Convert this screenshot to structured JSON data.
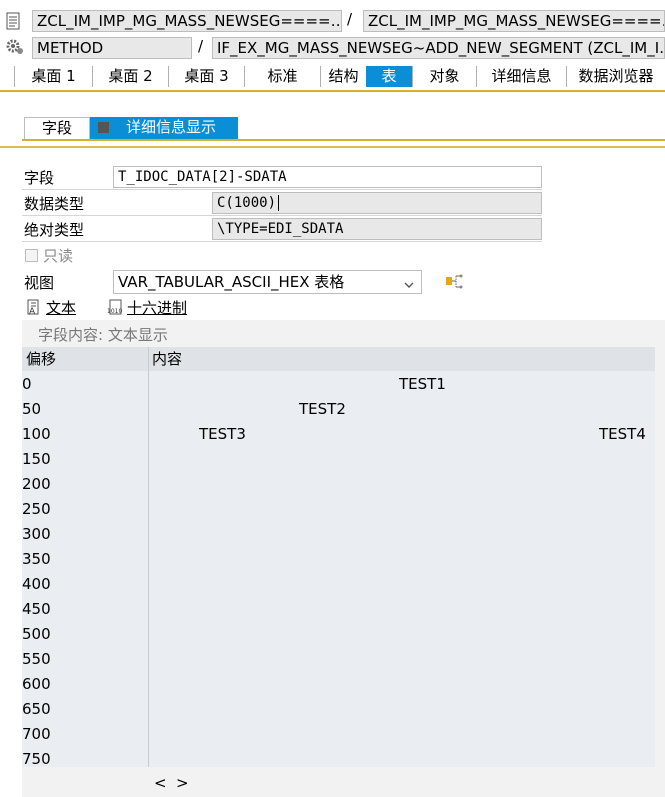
{
  "row1": {
    "field_a": "ZCL_IM_IMP_MG_MASS_NEWSEG====…",
    "separator": "/",
    "field_b": "ZCL_IM_IMP_MG_MASS_NEWSEG====…"
  },
  "row2": {
    "field_a": "METHOD",
    "separator": "/",
    "field_b": "IF_EX_MG_MASS_NEWSEG~ADD_NEW_SEGMENT (ZCL_IM_I…"
  },
  "tabs": [
    {
      "label": "桌面 1"
    },
    {
      "label": "桌面 2"
    },
    {
      "label": "桌面 3"
    },
    {
      "label": "标准"
    },
    {
      "label": "结构"
    },
    {
      "label": "表"
    },
    {
      "label": "对象"
    },
    {
      "label": "详细信息"
    },
    {
      "label": "数据浏览器"
    }
  ],
  "subtabs": {
    "field": "字段",
    "detail": "详细信息显示"
  },
  "form": {
    "field_label": "字段",
    "field_value": "T_IDOC_DATA[2]-SDATA",
    "datatype_label": "数据类型",
    "datatype_value": "C(1000)",
    "abstype_label": "绝对类型",
    "abstype_value": "\\TYPE=EDI_SDATA",
    "readonly_label": "只读",
    "view_label": "视图",
    "view_value": "VAR_TABULAR_ASCII_HEX 表格"
  },
  "toolbar": {
    "text_label": "文本",
    "hex_label": "十六进制"
  },
  "grid": {
    "caption": "字段内容: 文本显示",
    "col_offset": "偏移",
    "col_content": "内容",
    "offsets": [
      "0",
      "50",
      "100",
      "150",
      "200",
      "250",
      "300",
      "350",
      "400",
      "450",
      "500",
      "550",
      "600",
      "650",
      "700",
      "750"
    ],
    "cells": {
      "test1": "TEST1",
      "test2": "TEST2",
      "test3": "TEST3",
      "test4": "TEST4"
    },
    "scroll_left": "<",
    "scroll_right": ">"
  },
  "colors": {
    "tab_active": "#0a8fd6",
    "accent_gold": "#d4b035",
    "grid_bg": "#eaedf1"
  }
}
